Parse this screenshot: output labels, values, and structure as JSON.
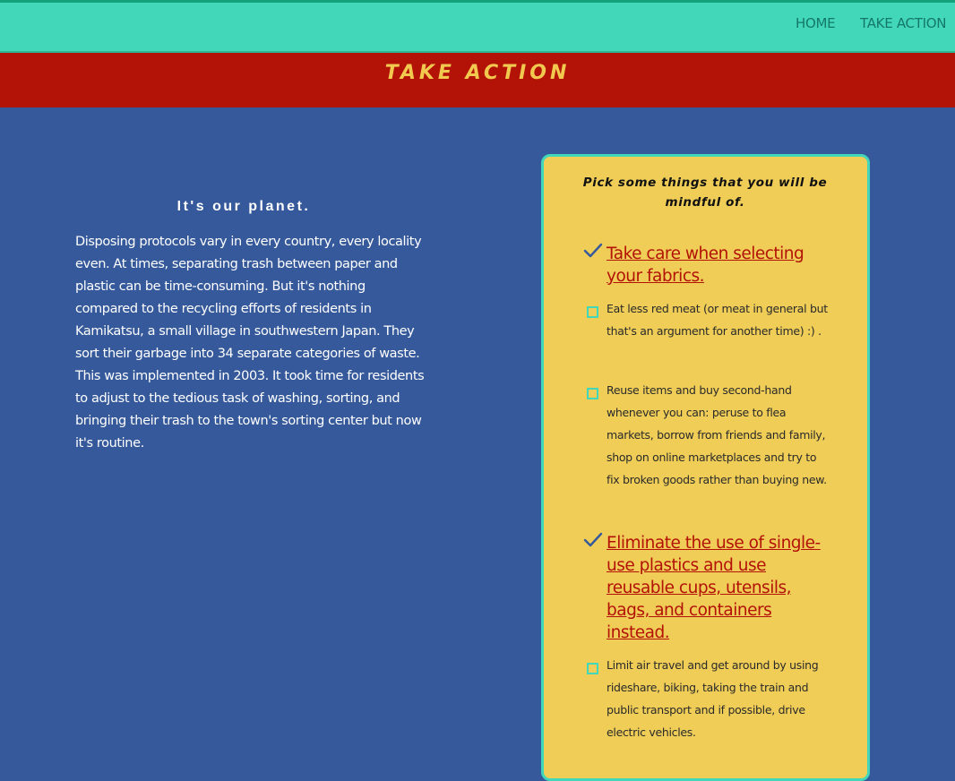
{
  "nav": {
    "home_label": "HOME",
    "take_action_label": "TAKE ACTION"
  },
  "banner": {
    "title": "TAKE ACTION"
  },
  "intro": {
    "heading": "It's our planet.",
    "body": "Disposing protocols vary in every country, every locality even. At times, separating trash between paper and plastic can be time-consuming. But it's nothing compared to the recycling efforts of residents in Kamikatsu, a small village in southwestern Japan. They sort their garbage into 34 separate categories of waste. This was implemented in 2003. It took time for residents to adjust to the tedious task of washing, sorting, and bringing their trash to the town's sorting center but now it's routine."
  },
  "checklist": {
    "heading": "Pick some things that you will be mindful of.",
    "items": [
      {
        "text": "Take care when selecting your fabrics.",
        "checked": true
      },
      {
        "text": "Eat less red meat (or meat in general but that's an argument for another time) :) .",
        "checked": false
      },
      {
        "text": "Reuse items and buy second-hand whenever you can: peruse to flea markets, borrow from friends and family, shop on online marketplaces and try to fix broken goods rather than buying new.",
        "checked": false
      },
      {
        "text": "Eliminate the use of single-use plastics and use reusable cups, utensils, bags, and containers instead.",
        "checked": true
      },
      {
        "text": "Limit air travel and get around by using rideshare, biking, taking the train and public transport and if possible, drive electric vehicles.",
        "checked": false
      }
    ]
  },
  "colors": {
    "nav_bg": "#43d7ba",
    "banner_bg": "#b31207",
    "banner_text": "#f2c94f",
    "page_bg": "#35599a",
    "card_bg": "#efcd57",
    "checked_text": "#b31207",
    "checkmark": "#35599a"
  }
}
